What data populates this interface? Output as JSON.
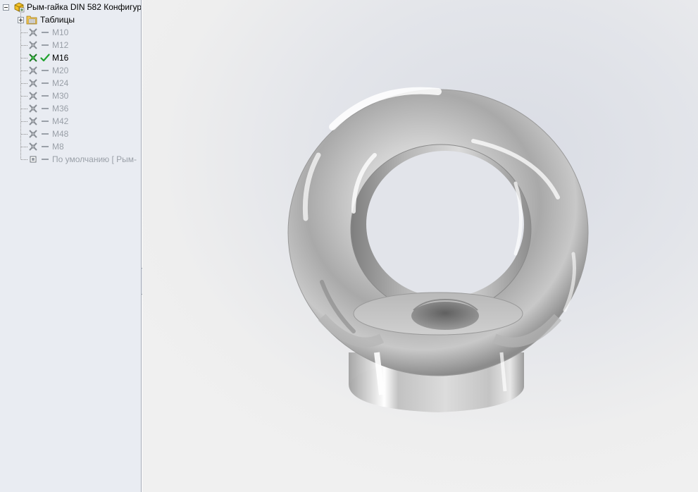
{
  "tree": {
    "root_label": "Рым-гайка DIN 582 Конфигур",
    "folder_label": "Таблицы",
    "configurations": [
      {
        "label": "M10",
        "active": false
      },
      {
        "label": "M12",
        "active": false
      },
      {
        "label": "M16",
        "active": true
      },
      {
        "label": "M20",
        "active": false
      },
      {
        "label": "M24",
        "active": false
      },
      {
        "label": "M30",
        "active": false
      },
      {
        "label": "M36",
        "active": false
      },
      {
        "label": "M42",
        "active": false
      },
      {
        "label": "M48",
        "active": false
      },
      {
        "label": "M8",
        "active": false
      }
    ],
    "default_config_label": "По умолчанию [ Рым-"
  },
  "icons": {
    "root": "part-config-icon",
    "folder": "table-folder-icon",
    "config": "configuration-icon",
    "active_state": "checkmark-icon",
    "inactive_state": "dash-icon",
    "default": "default-config-icon"
  },
  "colors": {
    "panel_bg": "#e9ecf2",
    "inactive_text": "#9aa0a8",
    "active_text": "#000000",
    "check_green": "#1fa22e",
    "viewport_bg": "#f0f0f0"
  }
}
